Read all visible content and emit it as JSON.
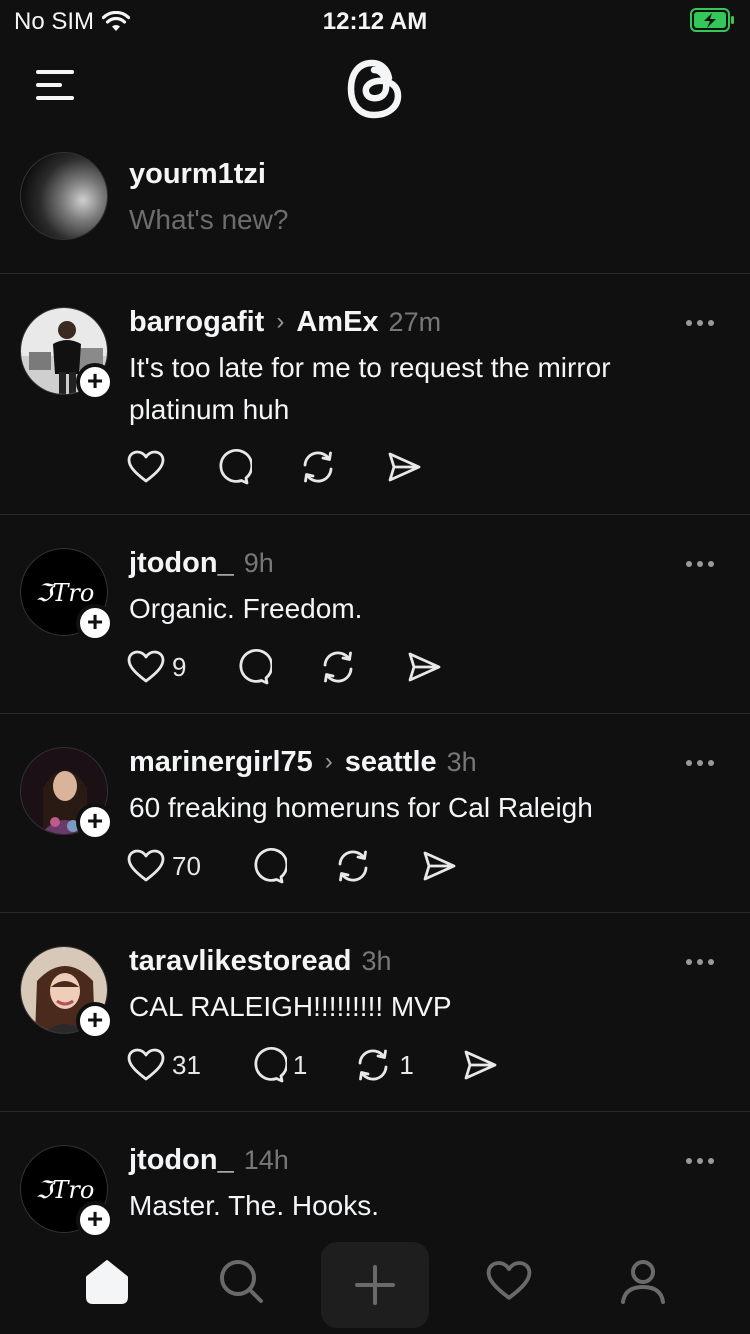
{
  "status": {
    "carrier": "No SIM",
    "time": "12:12 AM"
  },
  "composer": {
    "username": "yourm1tzi",
    "placeholder": "What's new?"
  },
  "posts": [
    {
      "author": "barrogafit",
      "community": "AmEx",
      "time": "27m",
      "text": "It's too late for me to request the mirror platinum huh",
      "likes": "",
      "replies": "",
      "reposts": ""
    },
    {
      "author": "jtodon_",
      "community": "",
      "time": "9h",
      "text": "Organic. Freedom.",
      "likes": "9",
      "replies": "",
      "reposts": ""
    },
    {
      "author": "marinergirl75",
      "community": "seattle",
      "time": "3h",
      "text": "60 freaking homeruns for Cal Raleigh",
      "likes": "70",
      "replies": "",
      "reposts": ""
    },
    {
      "author": "taravlikestoread",
      "community": "",
      "time": "3h",
      "text": "CAL RALEIGH!!!!!!!!! MVP",
      "likes": "31",
      "replies": "1",
      "reposts": "1"
    },
    {
      "author": "jtodon_",
      "community": "",
      "time": "14h",
      "text": "Master. The. Hooks.",
      "likes": "",
      "replies": "",
      "reposts": ""
    }
  ],
  "avatar_logo_text": "ℑTro",
  "icons": {
    "menu": "hamburger-icon",
    "logo": "threads-logo",
    "wifi": "wifi-icon",
    "battery": "battery-charging-icon",
    "like": "heart-icon",
    "reply": "comment-icon",
    "repost": "repost-icon",
    "share": "send-icon",
    "more": "more-horizontal-icon",
    "follow": "plus-icon",
    "home": "home-icon",
    "search": "search-icon",
    "create": "plus-icon",
    "activity": "heart-icon",
    "profile": "profile-icon"
  },
  "colors": {
    "background": "#101010",
    "text": "#f3f5f7",
    "muted": "#777777",
    "placeholder": "#6d6d6d",
    "divider": "#2a2a2a",
    "battery": "#34c759"
  }
}
